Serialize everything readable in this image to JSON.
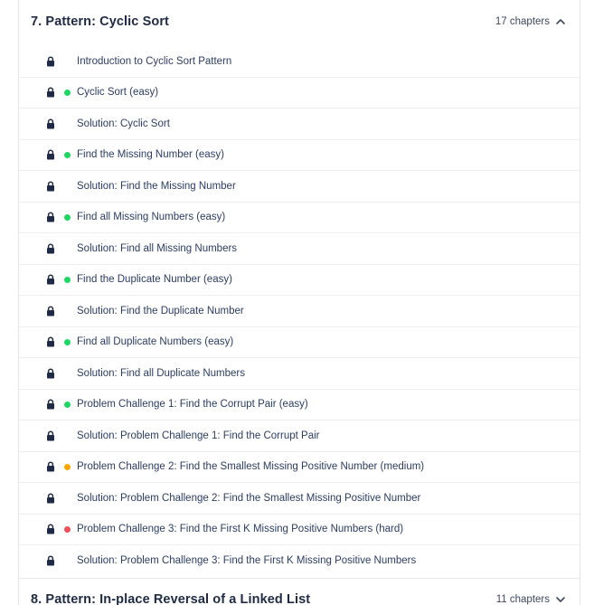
{
  "sections": [
    {
      "title": "7.  Pattern: Cyclic Sort",
      "chapters": "17 chapters",
      "expanded": true
    },
    {
      "title": "8.  Pattern: In-place Reversal of a Linked List",
      "chapters": "11 chapters",
      "expanded": false
    }
  ],
  "colors": {
    "easy": "#1ed760",
    "medium": "#ffa500",
    "hard": "#f0505a",
    "lock": "#1f2a44",
    "link": "#2b3c63"
  },
  "lessons": [
    {
      "label": "Introduction to Cyclic Sort Pattern",
      "difficulty": "none",
      "icon": "lock-icon"
    },
    {
      "label": "Cyclic Sort (easy)",
      "difficulty": "easy",
      "icon": "lock-icon"
    },
    {
      "label": "Solution: Cyclic Sort",
      "difficulty": "none",
      "icon": "lock-icon"
    },
    {
      "label": "Find the Missing Number (easy)",
      "difficulty": "easy",
      "icon": "lock-icon"
    },
    {
      "label": "Solution: Find the Missing Number",
      "difficulty": "none",
      "icon": "lock-icon"
    },
    {
      "label": "Find all Missing Numbers (easy)",
      "difficulty": "easy",
      "icon": "lock-icon"
    },
    {
      "label": "Solution: Find all Missing Numbers",
      "difficulty": "none",
      "icon": "lock-icon"
    },
    {
      "label": "Find the Duplicate Number (easy)",
      "difficulty": "easy",
      "icon": "lock-icon"
    },
    {
      "label": "Solution: Find the Duplicate Number",
      "difficulty": "none",
      "icon": "lock-icon"
    },
    {
      "label": "Find all Duplicate Numbers (easy)",
      "difficulty": "easy",
      "icon": "lock-icon"
    },
    {
      "label": "Solution: Find all Duplicate Numbers",
      "difficulty": "none",
      "icon": "lock-icon"
    },
    {
      "label": "Problem Challenge 1: Find the Corrupt Pair (easy)",
      "difficulty": "easy",
      "icon": "lock-icon"
    },
    {
      "label": "Solution: Problem Challenge 1: Find the Corrupt Pair",
      "difficulty": "none",
      "icon": "lock-icon"
    },
    {
      "label": "Problem Challenge 2: Find the Smallest Missing Positive Number (medium)",
      "difficulty": "medium",
      "icon": "lock-icon"
    },
    {
      "label": "Solution: Problem Challenge 2: Find the Smallest Missing Positive Number",
      "difficulty": "none",
      "icon": "lock-icon"
    },
    {
      "label": "Problem Challenge 3: Find the First K Missing Positive Numbers (hard)",
      "difficulty": "hard",
      "icon": "lock-icon"
    },
    {
      "label": "Solution: Problem Challenge 3: Find the First K Missing Positive Numbers",
      "difficulty": "none",
      "icon": "lock-icon"
    }
  ]
}
